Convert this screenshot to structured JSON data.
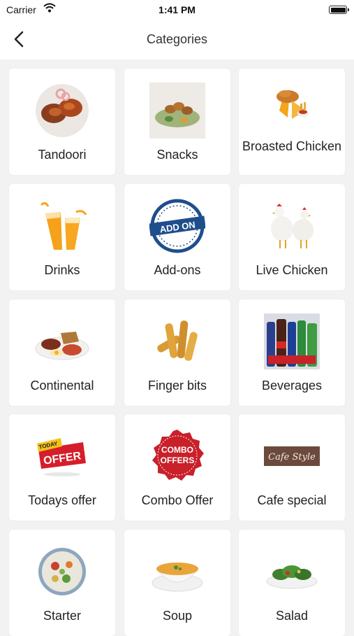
{
  "status_bar": {
    "carrier": "Carrier",
    "time": "1:41 PM"
  },
  "nav": {
    "title": "Categories",
    "back_icon": "chevron-left-icon"
  },
  "categories": [
    {
      "label": "Tandoori",
      "icon": "tandoori-chicken-image"
    },
    {
      "label": "Snacks",
      "icon": "snacks-plate-image"
    },
    {
      "label": "Broasted Chicken",
      "icon": "broasted-chicken-image"
    },
    {
      "label": "Drinks",
      "icon": "drinks-glasses-image"
    },
    {
      "label": "Add-ons",
      "icon": "add-on-badge-image",
      "badge_text": "ADD ON"
    },
    {
      "label": "Live Chicken",
      "icon": "live-chicken-image"
    },
    {
      "label": "Continental",
      "icon": "continental-breakfast-image"
    },
    {
      "label": "Finger bits",
      "icon": "finger-bits-image"
    },
    {
      "label": "Beverages",
      "icon": "beverages-bottles-image"
    },
    {
      "label": "Todays offer",
      "icon": "todays-offer-badge-image",
      "badge_top": "TODAY",
      "badge_main": "OFFER"
    },
    {
      "label": "Combo Offer",
      "icon": "combo-offers-badge-image",
      "badge_top": "COMBO",
      "badge_main": "OFFERS"
    },
    {
      "label": "Cafe special",
      "icon": "cafe-style-sign-image",
      "sign_text": "Cafe Style"
    },
    {
      "label": "Starter",
      "icon": "starter-salad-image"
    },
    {
      "label": "Soup",
      "icon": "soup-bowl-image"
    },
    {
      "label": "Salad",
      "icon": "salad-bowl-image"
    }
  ]
}
